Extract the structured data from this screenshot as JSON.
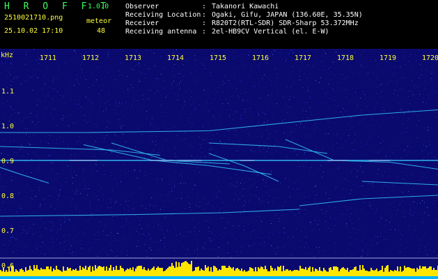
{
  "header": {
    "app_title": "H R O F F T",
    "app_version": "1.0.0",
    "file_name": "2510021710.png",
    "meteor_label": "meteor",
    "date_time": "25.10.02 17:10",
    "meteor_count": "48",
    "info": [
      {
        "key": "Observer",
        "value": "Takanori Kawachi"
      },
      {
        "key": "Receiving Location",
        "value": "Ogaki, Gifu, JAPAN (136.60E, 35.35N)"
      },
      {
        "key": "Receiver",
        "value": "R820T2(RTL-SDR) SDR-Sharp 53.372MHz"
      },
      {
        "key": "Receiving antenna",
        "value": "2el-HB9CV Vertical (el. E-W)"
      }
    ],
    "separator": ":"
  },
  "spectrogram": {
    "y_unit": "kHz",
    "y_ticks": [
      "1.1",
      "1.0",
      "0.9",
      "0.8",
      "0.7",
      "0.6"
    ],
    "x_ticks": [
      "1711",
      "1712",
      "1713",
      "1714",
      "1715",
      "1716",
      "1717",
      "1718",
      "1719",
      "1720"
    ],
    "colors": {
      "background": "#0a0a6e",
      "noise": "#2a2ad0",
      "trace": "#36c8ff",
      "hot": "#ff3c8c",
      "level": "#ffe600",
      "level_base": "#00b4ff",
      "axis_text": "#ffff3c"
    }
  }
}
